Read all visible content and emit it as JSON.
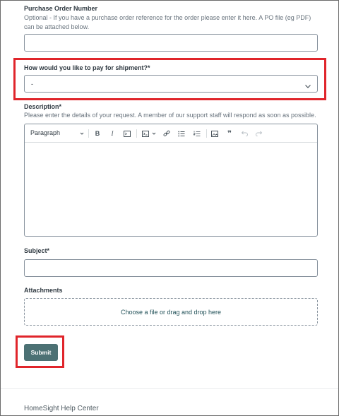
{
  "po": {
    "label": "Purchase Order Number",
    "hint": "Optional - If you have a purchase order reference for the order please enter it here. A PO file (eg PDF) can be attached below.",
    "value": ""
  },
  "payment": {
    "label": "How would you like to pay for shipment?*",
    "selected": "-",
    "icon": "chevron-down-icon"
  },
  "description": {
    "label": "Description*",
    "hint": "Please enter the details of your request. A member of our support staff will respond as soon as possible.",
    "toolbar": {
      "paragraph_label": "Paragraph",
      "items": [
        "bold-icon",
        "italic-icon",
        "code-icon",
        "code-block-icon",
        "link-icon",
        "bulleted-list-icon",
        "numbered-list-icon",
        "image-icon",
        "quote-icon",
        "undo-icon",
        "redo-icon"
      ]
    },
    "value": ""
  },
  "subject": {
    "label": "Subject*",
    "value": ""
  },
  "attachments": {
    "label": "Attachments",
    "dropzone_text": "Choose a file or drag and drop here"
  },
  "submit": {
    "label": "Submit"
  },
  "footer": {
    "text": "HomeSight Help Center"
  },
  "colors": {
    "highlight": "#e0252b",
    "submit_bg": "#4c7174",
    "border": "#87929d"
  }
}
